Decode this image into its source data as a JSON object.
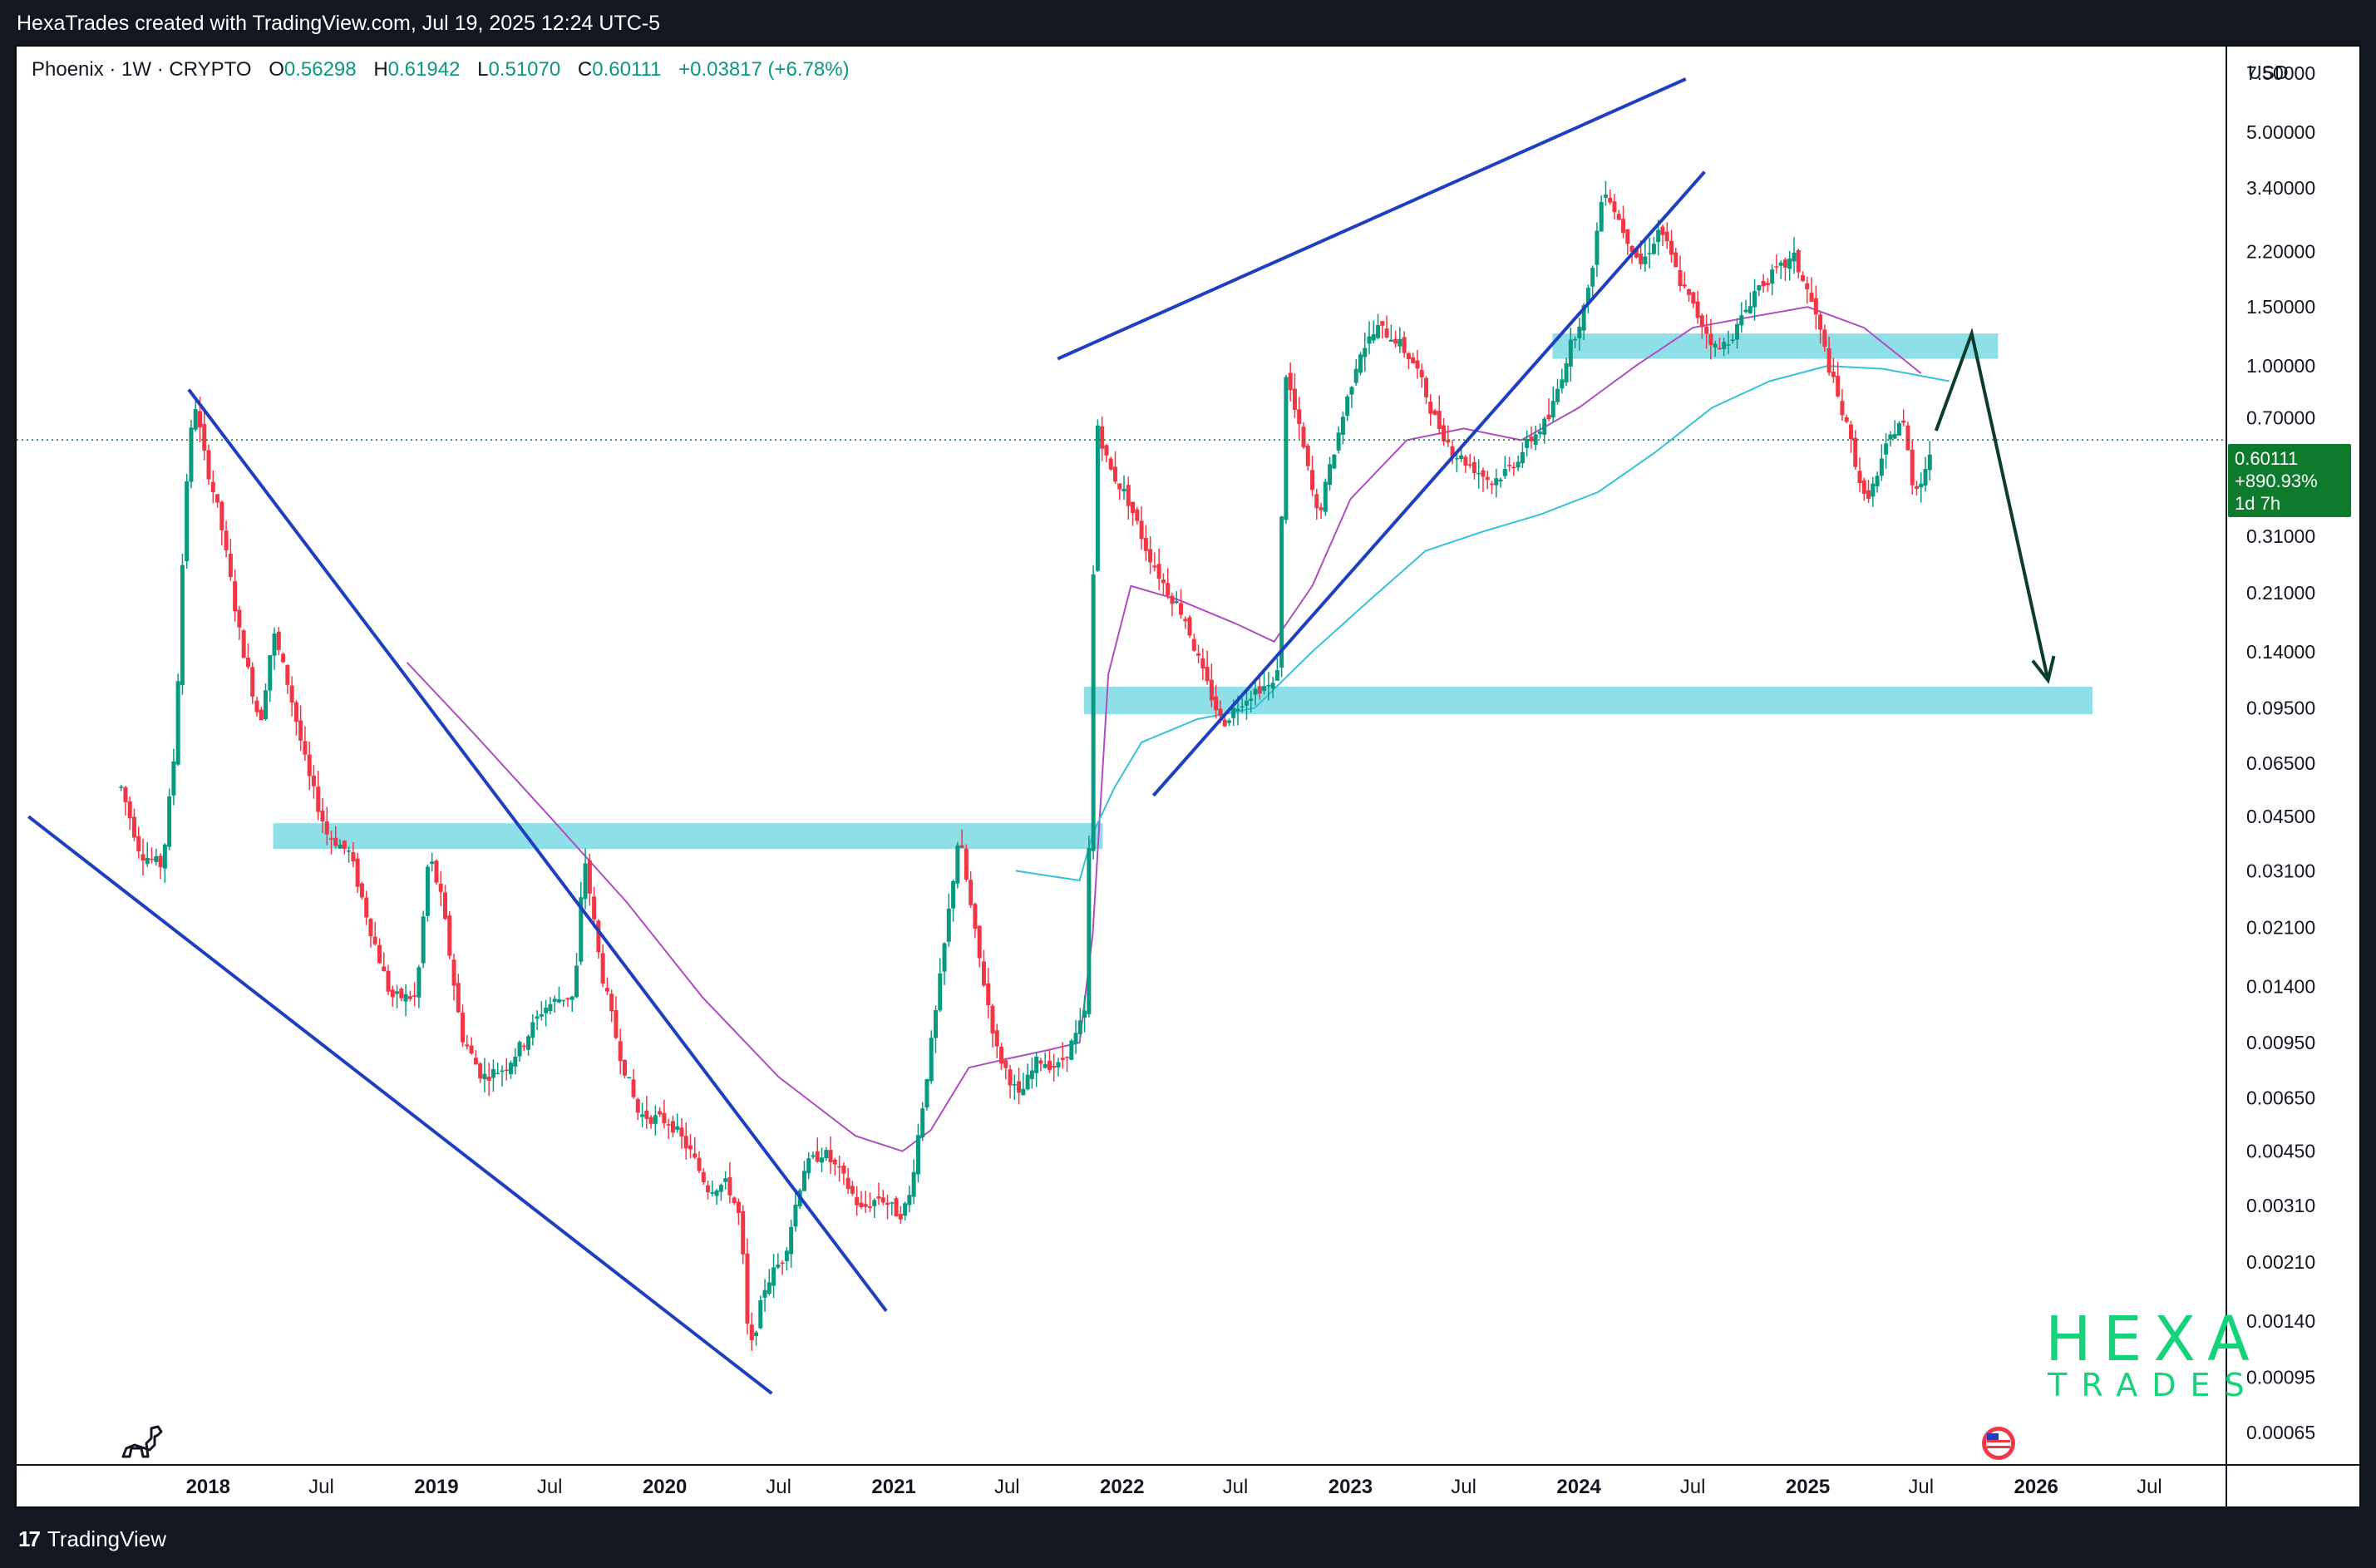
{
  "header": {
    "caption": "HexaTrades created with TradingView.com, Jul 19, 2025 12:24 UTC-5"
  },
  "legend": {
    "symbol": "Phoenix · 1W · CRYPTO",
    "open_label": "O",
    "open": "0.56298",
    "high_label": "H",
    "high": "0.61942",
    "low_label": "L",
    "low": "0.51070",
    "close_label": "C",
    "close": "0.60111",
    "change": "+0.03817 (+6.78%)"
  },
  "price_scale": {
    "currency": "USD"
  },
  "price_badge": {
    "price": "0.60111",
    "change_pct": "+890.93%",
    "countdown": "1d 7h"
  },
  "watermark": {
    "line1": "HEXA",
    "line2": "TRADES"
  },
  "footer": {
    "brand": "TradingView",
    "brand_logo": "17"
  },
  "colors": {
    "up": "#089981",
    "down": "#f23645",
    "trendline": "#1e3fbf",
    "zone": "#8fdfe9",
    "ma_purple": "#b04cc2",
    "ma_cyan": "#35c2d6",
    "projection": "#0b3d2a",
    "badge": "#0e7a2b",
    "logo": "#14d37a"
  },
  "chart_data": {
    "type": "candlestick",
    "symbol": "Phoenix",
    "interval": "1W",
    "y_scale": "log",
    "ylim": [
      0.00052,
      9.0
    ],
    "xlim": [
      "2017-03-01",
      "2026-11-01"
    ],
    "y_ticks": [
      "7.50000",
      "5.00000",
      "3.40000",
      "2.20000",
      "1.50000",
      "1.00000",
      "0.70000",
      "0.31000",
      "0.21000",
      "0.14000",
      "0.09500",
      "0.06500",
      "0.04500",
      "0.03100",
      "0.02100",
      "0.01400",
      "0.00950",
      "0.00650",
      "0.00450",
      "0.00310",
      "0.00210",
      "0.00140",
      "0.00095",
      "0.00065"
    ],
    "x_ticks": [
      {
        "label": "2018",
        "date": "2018-01-01",
        "bold": true
      },
      {
        "label": "Jul",
        "date": "2018-07-01",
        "bold": false
      },
      {
        "label": "2019",
        "date": "2019-01-01",
        "bold": true
      },
      {
        "label": "Jul",
        "date": "2019-07-01",
        "bold": false
      },
      {
        "label": "2020",
        "date": "2020-01-01",
        "bold": true
      },
      {
        "label": "Jul",
        "date": "2020-07-01",
        "bold": false
      },
      {
        "label": "2021",
        "date": "2021-01-01",
        "bold": true
      },
      {
        "label": "Jul",
        "date": "2021-07-01",
        "bold": false
      },
      {
        "label": "2022",
        "date": "2022-01-01",
        "bold": true
      },
      {
        "label": "Jul",
        "date": "2022-07-01",
        "bold": false
      },
      {
        "label": "2023",
        "date": "2023-01-01",
        "bold": true
      },
      {
        "label": "Jul",
        "date": "2023-07-01",
        "bold": false
      },
      {
        "label": "2024",
        "date": "2024-01-01",
        "bold": true
      },
      {
        "label": "Jul",
        "date": "2024-07-01",
        "bold": false
      },
      {
        "label": "2025",
        "date": "2025-01-01",
        "bold": true
      },
      {
        "label": "Jul",
        "date": "2025-07-01",
        "bold": false
      },
      {
        "label": "2026",
        "date": "2026-01-01",
        "bold": true
      },
      {
        "label": "Jul",
        "date": "2026-07-01",
        "bold": false
      }
    ],
    "price_path": [
      [
        "2017-08-15",
        0.055
      ],
      [
        "2017-09-15",
        0.035
      ],
      [
        "2017-10-20",
        0.032
      ],
      [
        "2017-11-10",
        0.075
      ],
      [
        "2017-11-25",
        0.4
      ],
      [
        "2017-12-10",
        0.8
      ],
      [
        "2017-12-25",
        0.55
      ],
      [
        "2018-01-20",
        0.35
      ],
      [
        "2018-02-20",
        0.16
      ],
      [
        "2018-03-25",
        0.085
      ],
      [
        "2018-04-15",
        0.16
      ],
      [
        "2018-05-10",
        0.11
      ],
      [
        "2018-06-10",
        0.06
      ],
      [
        "2018-07-10",
        0.04
      ],
      [
        "2018-08-15",
        0.035
      ],
      [
        "2018-09-20",
        0.02
      ],
      [
        "2018-10-20",
        0.013
      ],
      [
        "2018-11-30",
        0.013
      ],
      [
        "2018-12-20",
        0.035
      ],
      [
        "2019-01-10",
        0.025
      ],
      [
        "2019-02-10",
        0.01
      ],
      [
        "2019-03-15",
        0.0075
      ],
      [
        "2019-04-20",
        0.008
      ],
      [
        "2019-05-20",
        0.0095
      ],
      [
        "2019-06-20",
        0.012
      ],
      [
        "2019-07-20",
        0.013
      ],
      [
        "2019-08-10",
        0.013
      ],
      [
        "2019-08-25",
        0.035
      ],
      [
        "2019-09-20",
        0.016
      ],
      [
        "2019-10-20",
        0.009
      ],
      [
        "2019-11-20",
        0.0058
      ],
      [
        "2020-01-10",
        0.0055
      ],
      [
        "2020-02-10",
        0.0045
      ],
      [
        "2020-03-10",
        0.0035
      ],
      [
        "2020-04-10",
        0.0036
      ],
      [
        "2020-05-01",
        0.0028
      ],
      [
        "2020-05-15",
        0.0011
      ],
      [
        "2020-06-10",
        0.0018
      ],
      [
        "2020-07-10",
        0.0022
      ],
      [
        "2020-08-10",
        0.004
      ],
      [
        "2020-09-10",
        0.0045
      ],
      [
        "2020-10-10",
        0.0038
      ],
      [
        "2020-11-10",
        0.003
      ],
      [
        "2020-12-10",
        0.0033
      ],
      [
        "2021-01-10",
        0.0029
      ],
      [
        "2021-01-25",
        0.0032
      ],
      [
        "2021-02-15",
        0.006
      ],
      [
        "2021-03-10",
        0.012
      ],
      [
        "2021-04-15",
        0.04
      ],
      [
        "2021-05-15",
        0.018
      ],
      [
        "2021-06-15",
        0.009
      ],
      [
        "2021-07-20",
        0.0065
      ],
      [
        "2021-08-20",
        0.0085
      ],
      [
        "2021-09-20",
        0.008
      ],
      [
        "2021-10-20",
        0.01
      ],
      [
        "2021-11-05",
        0.012
      ],
      [
        "2021-11-20",
        0.7
      ],
      [
        "2021-12-10",
        0.5
      ],
      [
        "2022-01-10",
        0.4
      ],
      [
        "2022-02-10",
        0.28
      ],
      [
        "2022-03-10",
        0.22
      ],
      [
        "2022-04-10",
        0.18
      ],
      [
        "2022-05-10",
        0.12
      ],
      [
        "2022-06-10",
        0.085
      ],
      [
        "2022-07-10",
        0.1
      ],
      [
        "2022-08-10",
        0.11
      ],
      [
        "2022-09-05",
        0.11
      ],
      [
        "2022-09-20",
        0.95
      ],
      [
        "2022-10-15",
        0.6
      ],
      [
        "2022-11-10",
        0.35
      ],
      [
        "2022-12-10",
        0.6
      ],
      [
        "2023-01-15",
        1.1
      ],
      [
        "2023-02-15",
        1.3
      ],
      [
        "2023-03-15",
        1.2
      ],
      [
        "2023-04-15",
        1.0
      ],
      [
        "2023-05-15",
        0.7
      ],
      [
        "2023-06-15",
        0.55
      ],
      [
        "2023-07-15",
        0.5
      ],
      [
        "2023-08-15",
        0.45
      ],
      [
        "2023-09-15",
        0.5
      ],
      [
        "2023-10-15",
        0.6
      ],
      [
        "2023-11-15",
        0.7
      ],
      [
        "2023-12-15",
        1.1
      ],
      [
        "2024-01-15",
        1.6
      ],
      [
        "2024-02-10",
        3.5
      ],
      [
        "2024-03-10",
        2.6
      ],
      [
        "2024-04-10",
        2.0
      ],
      [
        "2024-05-10",
        2.6
      ],
      [
        "2024-06-10",
        1.8
      ],
      [
        "2024-07-10",
        1.4
      ],
      [
        "2024-08-10",
        1.1
      ],
      [
        "2024-09-10",
        1.3
      ],
      [
        "2024-10-10",
        1.7
      ],
      [
        "2024-11-10",
        1.9
      ],
      [
        "2024-12-10",
        2.1
      ],
      [
        "2025-01-10",
        1.5
      ],
      [
        "2025-02-10",
        0.9
      ],
      [
        "2025-03-10",
        0.6
      ],
      [
        "2025-04-01",
        0.4
      ],
      [
        "2025-04-20",
        0.45
      ],
      [
        "2025-05-10",
        0.6
      ],
      [
        "2025-06-01",
        0.7
      ],
      [
        "2025-06-20",
        0.42
      ],
      [
        "2025-07-10",
        0.5
      ],
      [
        "2025-07-19",
        0.60111
      ]
    ],
    "ma_purple": [
      [
        "2018-11-15",
        0.13
      ],
      [
        "2019-03-01",
        0.08
      ],
      [
        "2019-07-01",
        0.045
      ],
      [
        "2019-11-01",
        0.025
      ],
      [
        "2020-03-01",
        0.013
      ],
      [
        "2020-07-01",
        0.0075
      ],
      [
        "2020-11-01",
        0.005
      ],
      [
        "2021-01-15",
        0.0045
      ],
      [
        "2021-03-01",
        0.0052
      ],
      [
        "2021-05-01",
        0.008
      ],
      [
        "2021-07-01",
        0.0085
      ],
      [
        "2021-09-01",
        0.009
      ],
      [
        "2021-10-25",
        0.0095
      ],
      [
        "2021-11-15",
        0.02
      ],
      [
        "2021-12-10",
        0.12
      ],
      [
        "2022-01-15",
        0.22
      ],
      [
        "2022-04-01",
        0.2
      ],
      [
        "2022-07-01",
        0.17
      ],
      [
        "2022-09-01",
        0.15
      ],
      [
        "2022-11-01",
        0.22
      ],
      [
        "2023-01-01",
        0.4
      ],
      [
        "2023-04-01",
        0.6
      ],
      [
        "2023-07-01",
        0.65
      ],
      [
        "2023-10-01",
        0.6
      ],
      [
        "2024-01-01",
        0.75
      ],
      [
        "2024-04-01",
        1.0
      ],
      [
        "2024-07-01",
        1.3
      ],
      [
        "2024-10-01",
        1.4
      ],
      [
        "2025-01-01",
        1.5
      ],
      [
        "2025-04-01",
        1.3
      ],
      [
        "2025-07-01",
        0.95
      ]
    ],
    "ma_cyan": [
      [
        "2021-07-15",
        0.031
      ],
      [
        "2021-10-25",
        0.029
      ],
      [
        "2021-11-15",
        0.04
      ],
      [
        "2021-12-20",
        0.055
      ],
      [
        "2022-02-01",
        0.075
      ],
      [
        "2022-05-01",
        0.088
      ],
      [
        "2022-08-01",
        0.095
      ],
      [
        "2022-11-01",
        0.14
      ],
      [
        "2023-02-01",
        0.2
      ],
      [
        "2023-05-01",
        0.28
      ],
      [
        "2023-08-01",
        0.32
      ],
      [
        "2023-11-01",
        0.36
      ],
      [
        "2024-02-01",
        0.42
      ],
      [
        "2024-05-01",
        0.55
      ],
      [
        "2024-08-01",
        0.75
      ],
      [
        "2024-11-01",
        0.9
      ],
      [
        "2025-02-01",
        1.0
      ],
      [
        "2025-05-01",
        0.98
      ],
      [
        "2025-08-15",
        0.9
      ]
    ],
    "trendlines": [
      {
        "from": [
          "2017-03-20",
          0.045
        ],
        "to": [
          "2020-06-20",
          0.00085
        ]
      },
      {
        "from": [
          "2017-12-01",
          0.85
        ],
        "to": [
          "2020-12-20",
          0.0015
        ]
      },
      {
        "from": [
          "2021-09-20",
          1.05
        ],
        "to": [
          "2024-06-20",
          7.2
        ]
      },
      {
        "from": [
          "2022-02-20",
          0.052
        ],
        "to": [
          "2024-07-20",
          3.8
        ]
      }
    ],
    "zones": [
      {
        "from": "2018-04-15",
        "to": "2021-12-01",
        "y_top": 0.043,
        "y_bottom": 0.036
      },
      {
        "from": "2021-11-01",
        "to": "2026-04-01",
        "y_top": 0.11,
        "y_bottom": 0.091
      },
      {
        "from": "2023-11-20",
        "to": "2025-11-01",
        "y_top": 1.25,
        "y_bottom": 1.05
      }
    ],
    "projection": [
      [
        "2025-07-25",
        0.64
      ],
      [
        "2025-09-20",
        1.25
      ],
      [
        "2026-01-20",
        0.115
      ]
    ],
    "last_price": 0.60111
  }
}
